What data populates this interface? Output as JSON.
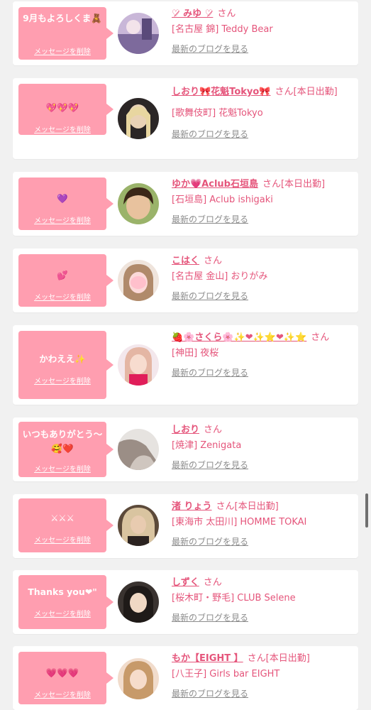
{
  "cards": [
    {
      "message": "9月もよろしくま🧸",
      "delete_label": "メッセージを削除",
      "name": "♡̷ みゆ ♡̷",
      "san": "さん",
      "shop": "[名古屋 錦] Teddy Bear",
      "blog": "最新のブログを見る"
    },
    {
      "message": "💖💖💖",
      "delete_label": "メッセージを削除",
      "name": "しおり🎀花魁Tokyo🎀",
      "san": "さん[本日出勤]",
      "shop": "[歌舞伎町] 花魁Tokyo",
      "blog": "最新のブログを見る"
    },
    {
      "message": "💜",
      "delete_label": "メッセージを削除",
      "name": "ゆか💗Aclub石垣島",
      "san": "さん[本日出勤]",
      "shop": "[石垣島] Aclub ishigaki",
      "blog": "最新のブログを見る"
    },
    {
      "message": "💕",
      "delete_label": "メッセージを削除",
      "name": "こはく",
      "san": "さん",
      "shop": "[名古屋 金山] おりがみ",
      "blog": "最新のブログを見る"
    },
    {
      "message": "かわええ✨",
      "delete_label": "メッセージを削除",
      "name": "🍓🌸さくら🌸✨❤✨⭐❤✨⭐",
      "san": "さん",
      "shop": "[神田] 夜桜",
      "blog": "最新のブログを見る"
    },
    {
      "message": "いつもありがとう〜🥰❤️",
      "delete_label": "メッセージを削除",
      "name": "しおり",
      "san": "さん",
      "shop": "[焼津] Zenigata",
      "blog": "最新のブログを見る"
    },
    {
      "message": "⚔⚔⚔",
      "delete_label": "メッセージを削除",
      "name": "渚 りょう",
      "san": "さん[本日出勤]",
      "shop": "[東海市 太田川] HOMME TOKAI",
      "blog": "最新のブログを見る"
    },
    {
      "message": "Thanks you❤\"",
      "delete_label": "メッセージを削除",
      "name": "しずく",
      "san": "さん",
      "shop": "[桜木町・野毛] CLUB Selene",
      "blog": "最新のブログを見る"
    },
    {
      "message": "💗💗💗",
      "delete_label": "メッセージを削除",
      "name": "もか【EIGHT 】",
      "san": "さん[本日出勤]",
      "shop": "[八王子] Girls bar EIGHT",
      "blog": "最新のブログを見る"
    }
  ],
  "colors": {
    "accent": "#e5557b",
    "bubble": "#ff9eb0",
    "link_gray": "#8c8c8c",
    "background": "#f1f1f1"
  }
}
